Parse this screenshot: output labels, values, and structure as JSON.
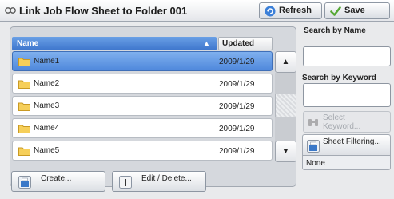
{
  "header": {
    "title": "Link Job Flow Sheet to Folder 001",
    "refresh_label": "Refresh",
    "save_label": "Save"
  },
  "table": {
    "columns": [
      "Name",
      "Updated"
    ],
    "rows": [
      {
        "name": "Name1",
        "updated": "2009/1/29",
        "selected": true
      },
      {
        "name": "Name2",
        "updated": "2009/1/29",
        "selected": false
      },
      {
        "name": "Name3",
        "updated": "2009/1/29",
        "selected": false
      },
      {
        "name": "Name4",
        "updated": "2009/1/29",
        "selected": false
      },
      {
        "name": "Name5",
        "updated": "2009/1/29",
        "selected": false
      }
    ],
    "sort_indicator": "▲",
    "scroll_up": "▲",
    "scroll_down": "▼"
  },
  "buttons": {
    "create": "Create...",
    "edit_delete": "Edit / Delete..."
  },
  "search": {
    "by_name_label": "Search by Name",
    "by_name_value": "",
    "by_keyword_label": "Search by Keyword",
    "by_keyword_value": "",
    "select_keyword_line1": "Select",
    "select_keyword_line2": "Keyword..."
  },
  "filter": {
    "label": "Sheet Filtering...",
    "value": "None"
  },
  "colors": {
    "accent": "#4f88dc",
    "folder": "#f3c54a"
  },
  "icons": [
    "job-flow-icon",
    "refresh-icon",
    "save-check-icon",
    "folder-icon",
    "create-icon",
    "edit-icon",
    "binoculars-icon",
    "filter-icon"
  ]
}
